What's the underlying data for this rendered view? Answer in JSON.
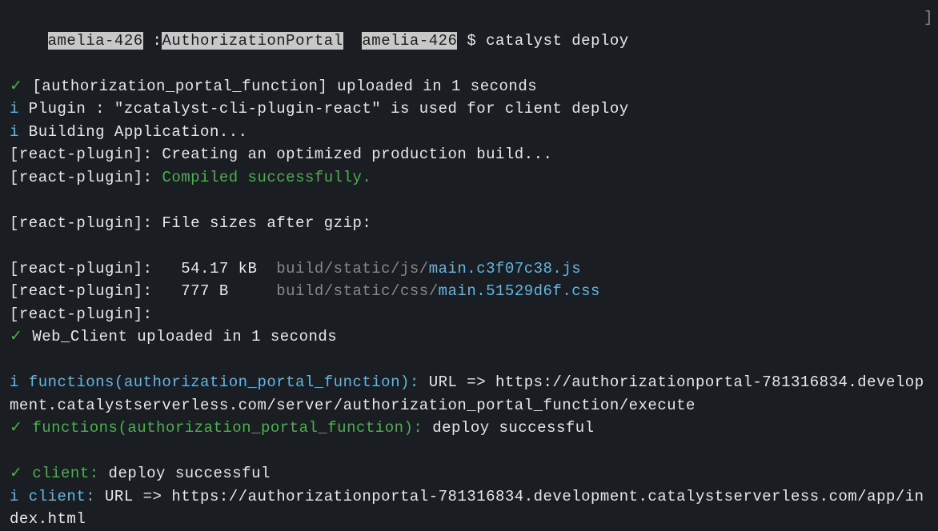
{
  "prompt": {
    "user_host_1": "amelia-426",
    "separator_1": " :",
    "directory": "AuthorizationPortal",
    "user_host_2": "amelia-426",
    "dollar": " $ ",
    "command": "catalyst deploy",
    "bracket_right": "]"
  },
  "icons": {
    "check": "✓",
    "info": "i"
  },
  "lines": {
    "upload1_a": " [authorization_portal_function] uploaded in 1 seconds",
    "plugin_a": " Plugin : \"zcatalyst-cli-plugin-react\" is used for client deploy",
    "building_a": " Building Application...",
    "rp_create": "[react-plugin]: Creating an optimized production build...",
    "rp_compiled_prefix": "[react-plugin]: ",
    "rp_compiled_msg": "Compiled successfully.",
    "blank": "",
    "rp_sizes": "[react-plugin]: File sizes after gzip:",
    "rp_file1_prefix": "[react-plugin]:   54.17 kB  ",
    "rp_file1_path": "build/static/js/",
    "rp_file1_name": "main.c3f07c38.js",
    "rp_file2_prefix": "[react-plugin]:   777 B     ",
    "rp_file2_path": "build/static/css/",
    "rp_file2_name": "main.51529d6f.css",
    "rp_empty": "[react-plugin]:",
    "webclient": " Web_Client uploaded in 1 seconds",
    "fn_url_label": " functions(authorization_portal_function):",
    "fn_url_rest": " URL => https://authorizationportal-781316834.development.catalystserverless.com/server/authorization_portal_function/execute",
    "fn_deploy_label": " functions(authorization_portal_function):",
    "fn_deploy_rest": " deploy successful",
    "client_deploy_label": " client:",
    "client_deploy_rest": " deploy successful",
    "client_url_label": " client:",
    "client_url_rest": " URL => https://authorizationportal-781316834.development.catalystserverless.com/app/index.html"
  }
}
